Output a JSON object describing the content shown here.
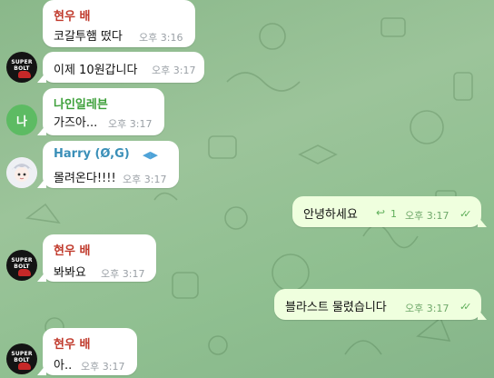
{
  "colors": {
    "chat_bg": "#8fbf90",
    "bubble_in": "#ffffff",
    "bubble_out": "#efffde",
    "sender_red": "#c0392b",
    "sender_green": "#3da03a",
    "sender_blue": "#3a8fb8",
    "time_gray": "#9aa0a6",
    "time_out_green": "#6fa86a"
  },
  "messages": [
    {
      "sender": "현우 배",
      "text": "코갈투햄 떴다",
      "time": "오후 3:16"
    },
    {
      "text": "이제 10원갑니다",
      "time": "오후 3:17"
    },
    {
      "sender": "나인일레븐",
      "text": "가즈아...",
      "time": "오후 3:17",
      "avatar_letter": "나"
    },
    {
      "sender": "Harry (Ø,G)",
      "text": "몰려온다!!!!",
      "time": "오후 3:17",
      "badge_icon": "broadcast-icon"
    },
    {
      "text": "안녕하세요",
      "time": "오후 3:17",
      "reply_count": "1"
    },
    {
      "sender": "현우 배",
      "text": "봐봐요",
      "time": "오후 3:17"
    },
    {
      "text": "블라스트 물렸습니다",
      "time": "오후 3:17"
    },
    {
      "sender": "현우 배",
      "text": "아..",
      "time": "오후 3:17"
    }
  ],
  "avatar_logo": {
    "line1": "SUPER",
    "line2": "BOLT"
  },
  "read_checks": "✓✓"
}
